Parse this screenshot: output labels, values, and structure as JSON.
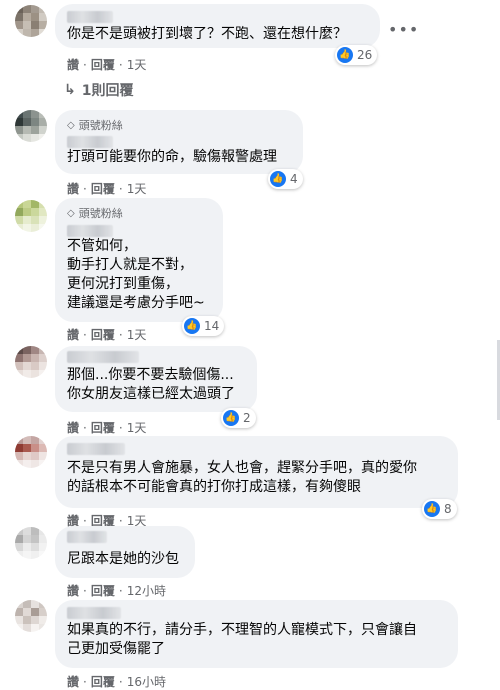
{
  "colors": {
    "bubble": "#f0f2f5",
    "like": "#1877f2",
    "muted": "#65676b"
  },
  "icons": {
    "like": "thumbs-up-icon",
    "badge": "diamond-icon",
    "reply": "reply-arrow-icon",
    "more": "more-icon"
  },
  "comments": [
    {
      "text": "你是不是頭被打到壞了？不跑、還在想什麼？",
      "reactions": "26",
      "like": "讚",
      "reply": "回覆",
      "time": "1天",
      "replies_label": "1則回覆"
    },
    {
      "badge": "頭號粉絲",
      "text": "打頭可能要你的命，驗傷報警處理",
      "reactions": "4",
      "like": "讚",
      "reply": "回覆",
      "time": "1天"
    },
    {
      "badge": "頭號粉絲",
      "text": "不管如何，\n動手打人就是不對，\n更何況打到重傷，\n建議還是考慮分手吧~",
      "reactions": "14",
      "like": "讚",
      "reply": "回覆",
      "time": "1天"
    },
    {
      "text": "那個...你要不要去驗個傷...\n你女朋友這樣已經太過頭了",
      "reactions": "2",
      "like": "讚",
      "reply": "回覆",
      "time": "1天"
    },
    {
      "text": "不是只有男人會施暴，女人也會，趕緊分手吧，真的愛你\n的話根本不可能會真的打你打成這樣，有夠傻眼",
      "reactions": "8",
      "like": "讚",
      "reply": "回覆",
      "time": "1天"
    },
    {
      "text": "尼跟本是她的沙包",
      "like": "讚",
      "reply": "回覆",
      "time": "12小時"
    },
    {
      "text": "如果真的不行，請分手，不理智的人寵模式下，只會讓自\n己更加受傷罷了",
      "like": "讚",
      "reply": "回覆",
      "time": "16小時"
    }
  ]
}
